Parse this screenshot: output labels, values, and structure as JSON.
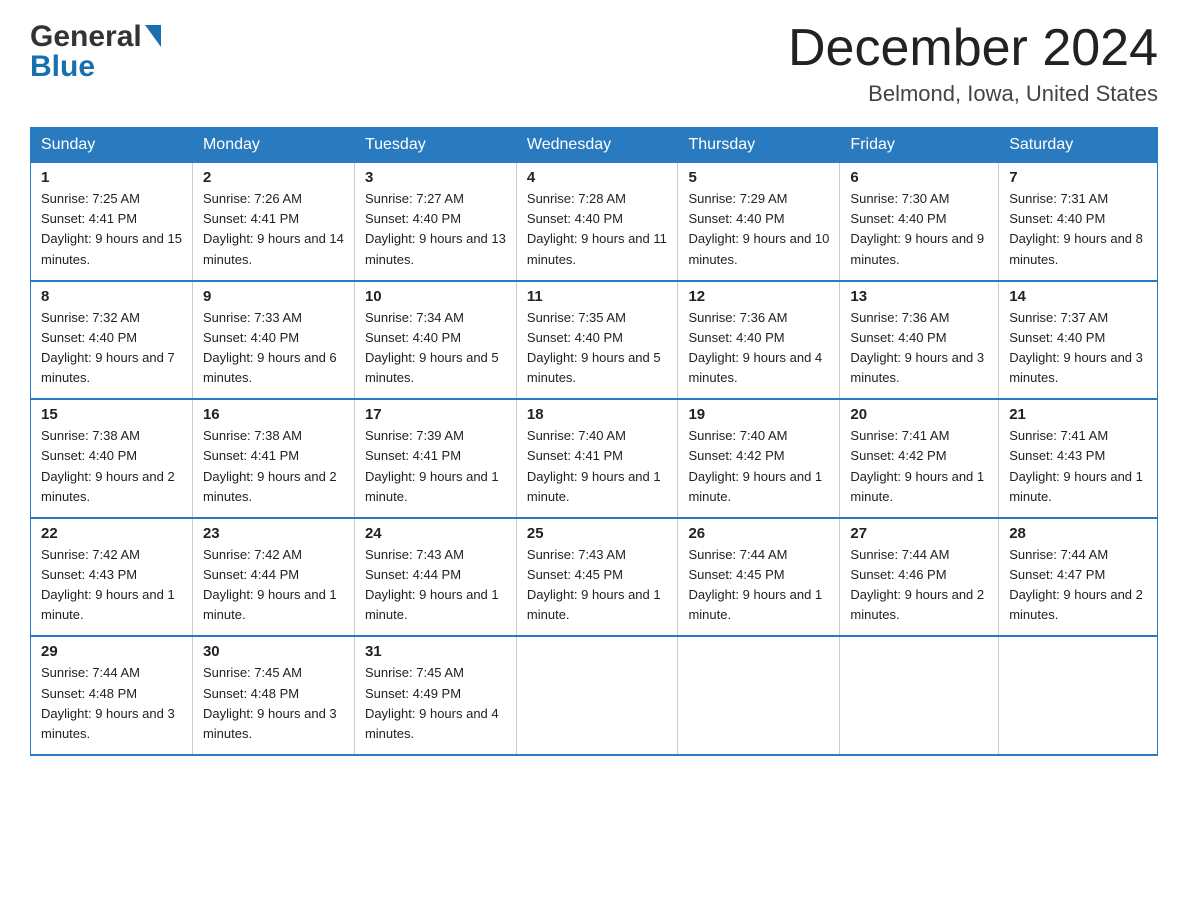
{
  "header": {
    "logo_line1": "General",
    "logo_line2": "Blue",
    "month": "December 2024",
    "location": "Belmond, Iowa, United States"
  },
  "weekdays": [
    "Sunday",
    "Monday",
    "Tuesday",
    "Wednesday",
    "Thursday",
    "Friday",
    "Saturday"
  ],
  "weeks": [
    [
      {
        "day": "1",
        "sunrise": "Sunrise: 7:25 AM",
        "sunset": "Sunset: 4:41 PM",
        "daylight": "Daylight: 9 hours and 15 minutes."
      },
      {
        "day": "2",
        "sunrise": "Sunrise: 7:26 AM",
        "sunset": "Sunset: 4:41 PM",
        "daylight": "Daylight: 9 hours and 14 minutes."
      },
      {
        "day": "3",
        "sunrise": "Sunrise: 7:27 AM",
        "sunset": "Sunset: 4:40 PM",
        "daylight": "Daylight: 9 hours and 13 minutes."
      },
      {
        "day": "4",
        "sunrise": "Sunrise: 7:28 AM",
        "sunset": "Sunset: 4:40 PM",
        "daylight": "Daylight: 9 hours and 11 minutes."
      },
      {
        "day": "5",
        "sunrise": "Sunrise: 7:29 AM",
        "sunset": "Sunset: 4:40 PM",
        "daylight": "Daylight: 9 hours and 10 minutes."
      },
      {
        "day": "6",
        "sunrise": "Sunrise: 7:30 AM",
        "sunset": "Sunset: 4:40 PM",
        "daylight": "Daylight: 9 hours and 9 minutes."
      },
      {
        "day": "7",
        "sunrise": "Sunrise: 7:31 AM",
        "sunset": "Sunset: 4:40 PM",
        "daylight": "Daylight: 9 hours and 8 minutes."
      }
    ],
    [
      {
        "day": "8",
        "sunrise": "Sunrise: 7:32 AM",
        "sunset": "Sunset: 4:40 PM",
        "daylight": "Daylight: 9 hours and 7 minutes."
      },
      {
        "day": "9",
        "sunrise": "Sunrise: 7:33 AM",
        "sunset": "Sunset: 4:40 PM",
        "daylight": "Daylight: 9 hours and 6 minutes."
      },
      {
        "day": "10",
        "sunrise": "Sunrise: 7:34 AM",
        "sunset": "Sunset: 4:40 PM",
        "daylight": "Daylight: 9 hours and 5 minutes."
      },
      {
        "day": "11",
        "sunrise": "Sunrise: 7:35 AM",
        "sunset": "Sunset: 4:40 PM",
        "daylight": "Daylight: 9 hours and 5 minutes."
      },
      {
        "day": "12",
        "sunrise": "Sunrise: 7:36 AM",
        "sunset": "Sunset: 4:40 PM",
        "daylight": "Daylight: 9 hours and 4 minutes."
      },
      {
        "day": "13",
        "sunrise": "Sunrise: 7:36 AM",
        "sunset": "Sunset: 4:40 PM",
        "daylight": "Daylight: 9 hours and 3 minutes."
      },
      {
        "day": "14",
        "sunrise": "Sunrise: 7:37 AM",
        "sunset": "Sunset: 4:40 PM",
        "daylight": "Daylight: 9 hours and 3 minutes."
      }
    ],
    [
      {
        "day": "15",
        "sunrise": "Sunrise: 7:38 AM",
        "sunset": "Sunset: 4:40 PM",
        "daylight": "Daylight: 9 hours and 2 minutes."
      },
      {
        "day": "16",
        "sunrise": "Sunrise: 7:38 AM",
        "sunset": "Sunset: 4:41 PM",
        "daylight": "Daylight: 9 hours and 2 minutes."
      },
      {
        "day": "17",
        "sunrise": "Sunrise: 7:39 AM",
        "sunset": "Sunset: 4:41 PM",
        "daylight": "Daylight: 9 hours and 1 minute."
      },
      {
        "day": "18",
        "sunrise": "Sunrise: 7:40 AM",
        "sunset": "Sunset: 4:41 PM",
        "daylight": "Daylight: 9 hours and 1 minute."
      },
      {
        "day": "19",
        "sunrise": "Sunrise: 7:40 AM",
        "sunset": "Sunset: 4:42 PM",
        "daylight": "Daylight: 9 hours and 1 minute."
      },
      {
        "day": "20",
        "sunrise": "Sunrise: 7:41 AM",
        "sunset": "Sunset: 4:42 PM",
        "daylight": "Daylight: 9 hours and 1 minute."
      },
      {
        "day": "21",
        "sunrise": "Sunrise: 7:41 AM",
        "sunset": "Sunset: 4:43 PM",
        "daylight": "Daylight: 9 hours and 1 minute."
      }
    ],
    [
      {
        "day": "22",
        "sunrise": "Sunrise: 7:42 AM",
        "sunset": "Sunset: 4:43 PM",
        "daylight": "Daylight: 9 hours and 1 minute."
      },
      {
        "day": "23",
        "sunrise": "Sunrise: 7:42 AM",
        "sunset": "Sunset: 4:44 PM",
        "daylight": "Daylight: 9 hours and 1 minute."
      },
      {
        "day": "24",
        "sunrise": "Sunrise: 7:43 AM",
        "sunset": "Sunset: 4:44 PM",
        "daylight": "Daylight: 9 hours and 1 minute."
      },
      {
        "day": "25",
        "sunrise": "Sunrise: 7:43 AM",
        "sunset": "Sunset: 4:45 PM",
        "daylight": "Daylight: 9 hours and 1 minute."
      },
      {
        "day": "26",
        "sunrise": "Sunrise: 7:44 AM",
        "sunset": "Sunset: 4:45 PM",
        "daylight": "Daylight: 9 hours and 1 minute."
      },
      {
        "day": "27",
        "sunrise": "Sunrise: 7:44 AM",
        "sunset": "Sunset: 4:46 PM",
        "daylight": "Daylight: 9 hours and 2 minutes."
      },
      {
        "day": "28",
        "sunrise": "Sunrise: 7:44 AM",
        "sunset": "Sunset: 4:47 PM",
        "daylight": "Daylight: 9 hours and 2 minutes."
      }
    ],
    [
      {
        "day": "29",
        "sunrise": "Sunrise: 7:44 AM",
        "sunset": "Sunset: 4:48 PM",
        "daylight": "Daylight: 9 hours and 3 minutes."
      },
      {
        "day": "30",
        "sunrise": "Sunrise: 7:45 AM",
        "sunset": "Sunset: 4:48 PM",
        "daylight": "Daylight: 9 hours and 3 minutes."
      },
      {
        "day": "31",
        "sunrise": "Sunrise: 7:45 AM",
        "sunset": "Sunset: 4:49 PM",
        "daylight": "Daylight: 9 hours and 4 minutes."
      },
      null,
      null,
      null,
      null
    ]
  ]
}
